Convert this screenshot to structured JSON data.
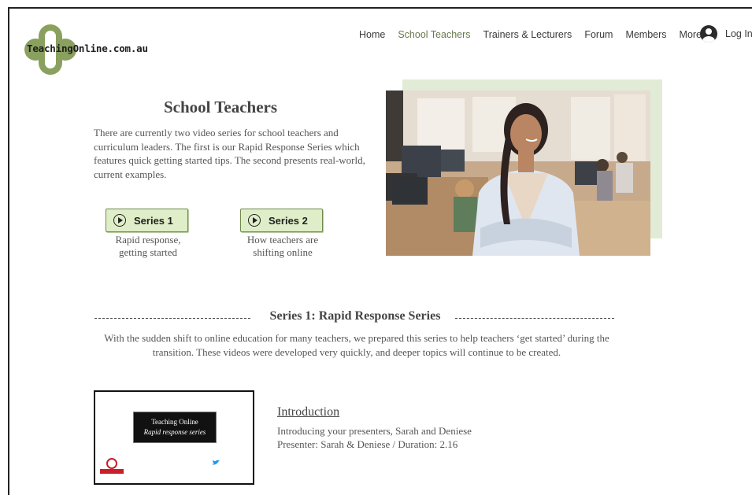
{
  "brand": {
    "logo_text": "TeachingOnline.com.au",
    "accent": "#8aa05f",
    "accent_dark": "#667a4c"
  },
  "nav": {
    "items": [
      "Home",
      "School Teachers",
      "Trainers & Lecturers",
      "Forum",
      "Members",
      "More"
    ],
    "active_index": 1,
    "login_label": "Log In"
  },
  "hero": {
    "title": "School Teachers",
    "intro": "There are currently two video series for school teachers and curriculum leaders. The first is our Rapid Response Series which features quick getting started tips. The second presents real-world, current examples."
  },
  "series_buttons": [
    {
      "label": "Series 1",
      "caption": "Rapid response, getting started"
    },
    {
      "label": "Series 2",
      "caption": "How teachers are shifting online"
    }
  ],
  "section": {
    "title": "Series 1: Rapid Response Series",
    "description": "With the sudden shift to online education for many teachers, we prepared this series to help teachers ‘get started’ during the transition. These videos were developed very quickly, and deeper topics will continue to be created."
  },
  "video": {
    "thumb_title": "Teaching Online",
    "thumb_subtitle": "Rapid response series",
    "title": "Introduction",
    "desc_line1": "Introducing your presenters, Sarah and Deniese",
    "desc_line2": "Presenter: Sarah & Deniese / Duration: 2.16"
  }
}
